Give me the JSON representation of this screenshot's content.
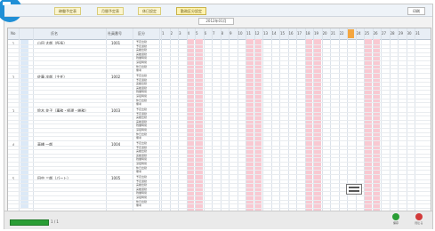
{
  "tabs": [
    "稼働予定表",
    "月間予定表",
    "休日設定",
    "勤務区分設定"
  ],
  "active_tab_index": 3,
  "print_label": "印刷",
  "date_label": "2012年01月",
  "header": {
    "no": "No",
    "name": "氏名",
    "code": "社員番号",
    "kind": "区分",
    "days": [
      "1",
      "2",
      "3",
      "4",
      "5",
      "6",
      "7",
      "8",
      "9",
      "10",
      "11",
      "12",
      "13",
      "14",
      "15",
      "16",
      "17",
      "18",
      "19",
      "20",
      "21",
      "22",
      "23",
      "24",
      "25",
      "26",
      "27",
      "28",
      "29",
      "30",
      "31"
    ]
  },
  "employees": [
    {
      "no": "1",
      "name": "山田 太郎（所長）",
      "code": "1001"
    },
    {
      "no": "2",
      "name": "佐藤 次郎（主任）",
      "code": "1002"
    },
    {
      "no": "3",
      "name": "鈴木 花子（事務・経理・総務）",
      "code": "1003"
    },
    {
      "no": "4",
      "name": "高橋 一郎",
      "code": "1004"
    },
    {
      "no": "5",
      "name": "田中 三郎（パート）",
      "code": "1005"
    }
  ],
  "sub_labels": [
    "予定出勤",
    "予定退勤",
    "実績出勤",
    "実績退勤",
    "残業時間",
    "深夜時間",
    "休日出勤",
    "備考"
  ],
  "bottom": {
    "progress_label": "",
    "pager": "1 / 1",
    "save_label": "保存",
    "close_label": "閉じる"
  },
  "colors": {
    "weekend": "#f9c9d2",
    "today": "#f4a640",
    "accent": "#1f8fd6",
    "progress": "#2a9d35",
    "close": "#d23b3b"
  }
}
